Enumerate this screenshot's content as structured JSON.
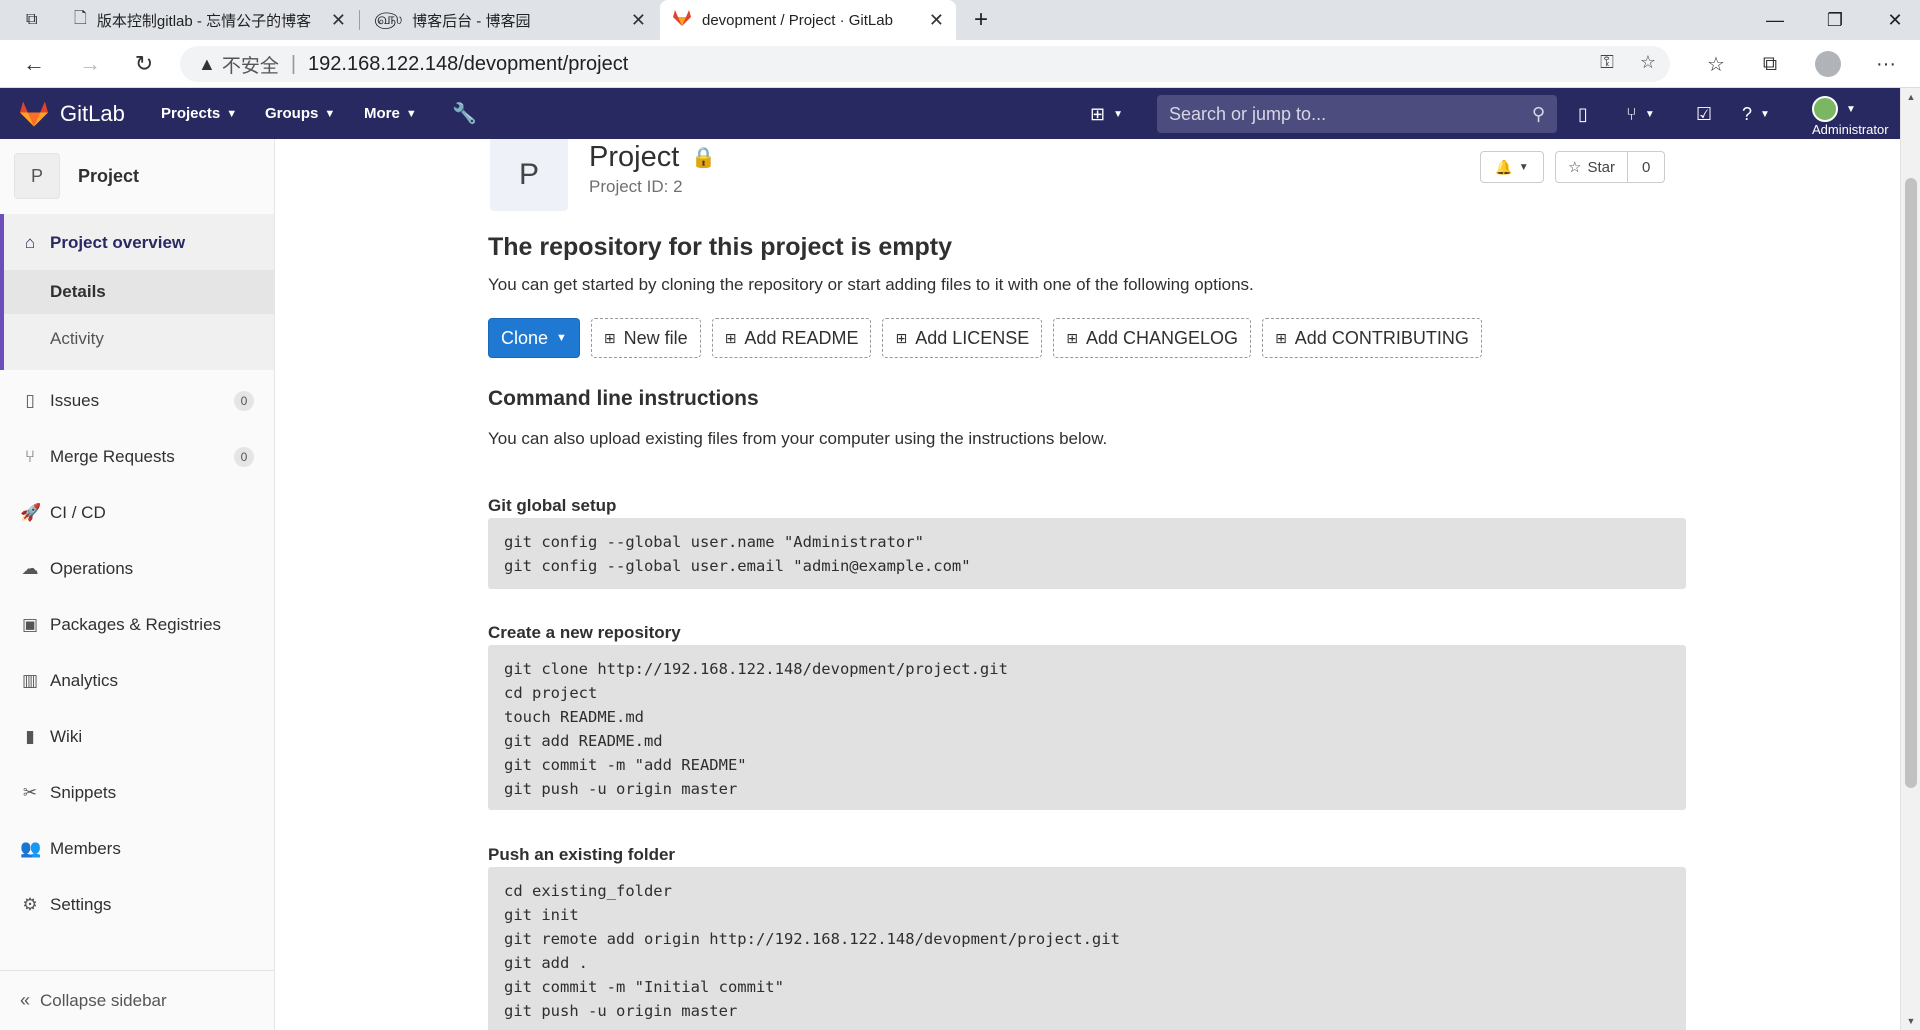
{
  "browser": {
    "tabs": [
      {
        "title": "版本控制gitlab - 忘情公子的博客",
        "icon": "document-icon"
      },
      {
        "title": "博客后台 - 博客园",
        "icon": "cnblogs-icon"
      },
      {
        "title": "devopment / Project · GitLab",
        "icon": "gitlab-tanuki-icon",
        "active": true
      }
    ],
    "new_tab": "+",
    "address": {
      "security_label": "不安全",
      "url": "192.168.122.148/devopment/project"
    }
  },
  "gitlab_nav": {
    "brand": "GitLab",
    "menus": [
      "Projects",
      "Groups",
      "More"
    ],
    "search_placeholder": "Search or jump to...",
    "user_label": "Administrator"
  },
  "sidebar": {
    "project_letter": "P",
    "project_name": "Project",
    "overview": {
      "label": "Project overview",
      "sub": [
        "Details",
        "Activity"
      ],
      "active_sub": "Details"
    },
    "items": [
      {
        "label": "Issues",
        "count": "0",
        "icon": "issues-icon"
      },
      {
        "label": "Merge Requests",
        "count": "0",
        "icon": "merge-request-icon"
      },
      {
        "label": "CI / CD",
        "icon": "rocket-icon"
      },
      {
        "label": "Operations",
        "icon": "cloud-gear-icon"
      },
      {
        "label": "Packages & Registries",
        "icon": "package-icon"
      },
      {
        "label": "Analytics",
        "icon": "chart-icon"
      },
      {
        "label": "Wiki",
        "icon": "book-icon"
      },
      {
        "label": "Snippets",
        "icon": "scissors-icon"
      },
      {
        "label": "Members",
        "icon": "users-icon"
      },
      {
        "label": "Settings",
        "icon": "gear-icon"
      }
    ],
    "collapse_label": "Collapse sidebar"
  },
  "project": {
    "avatar_letter": "P",
    "title": "Project",
    "id_label": "Project ID: 2",
    "star_label": "Star",
    "star_count": "0"
  },
  "empty": {
    "heading": "The repository for this project is empty",
    "text": "You can get started by cloning the repository or start adding files to it with one of the following options."
  },
  "actions": {
    "clone": "Clone",
    "buttons": [
      "New file",
      "Add README",
      "Add LICENSE",
      "Add CHANGELOG",
      "Add CONTRIBUTING"
    ]
  },
  "cli": {
    "heading": "Command line instructions",
    "text": "You can also upload existing files from your computer using the instructions below.",
    "sections": [
      {
        "title": "Git global setup",
        "code": "git config --global user.name \"Administrator\"\ngit config --global user.email \"admin@example.com\""
      },
      {
        "title": "Create a new repository",
        "code": "git clone http://192.168.122.148/devopment/project.git\ncd project\ntouch README.md\ngit add README.md\ngit commit -m \"add README\"\ngit push -u origin master"
      },
      {
        "title": "Push an existing folder",
        "code": "cd existing_folder\ngit init\ngit remote add origin http://192.168.122.148/devopment/project.git\ngit add .\ngit commit -m \"Initial commit\"\ngit push -u origin master"
      }
    ]
  },
  "colors": {
    "navbar": "#292961",
    "primary": "#1f78d1",
    "sidebar_accent": "#6b4fbb"
  }
}
